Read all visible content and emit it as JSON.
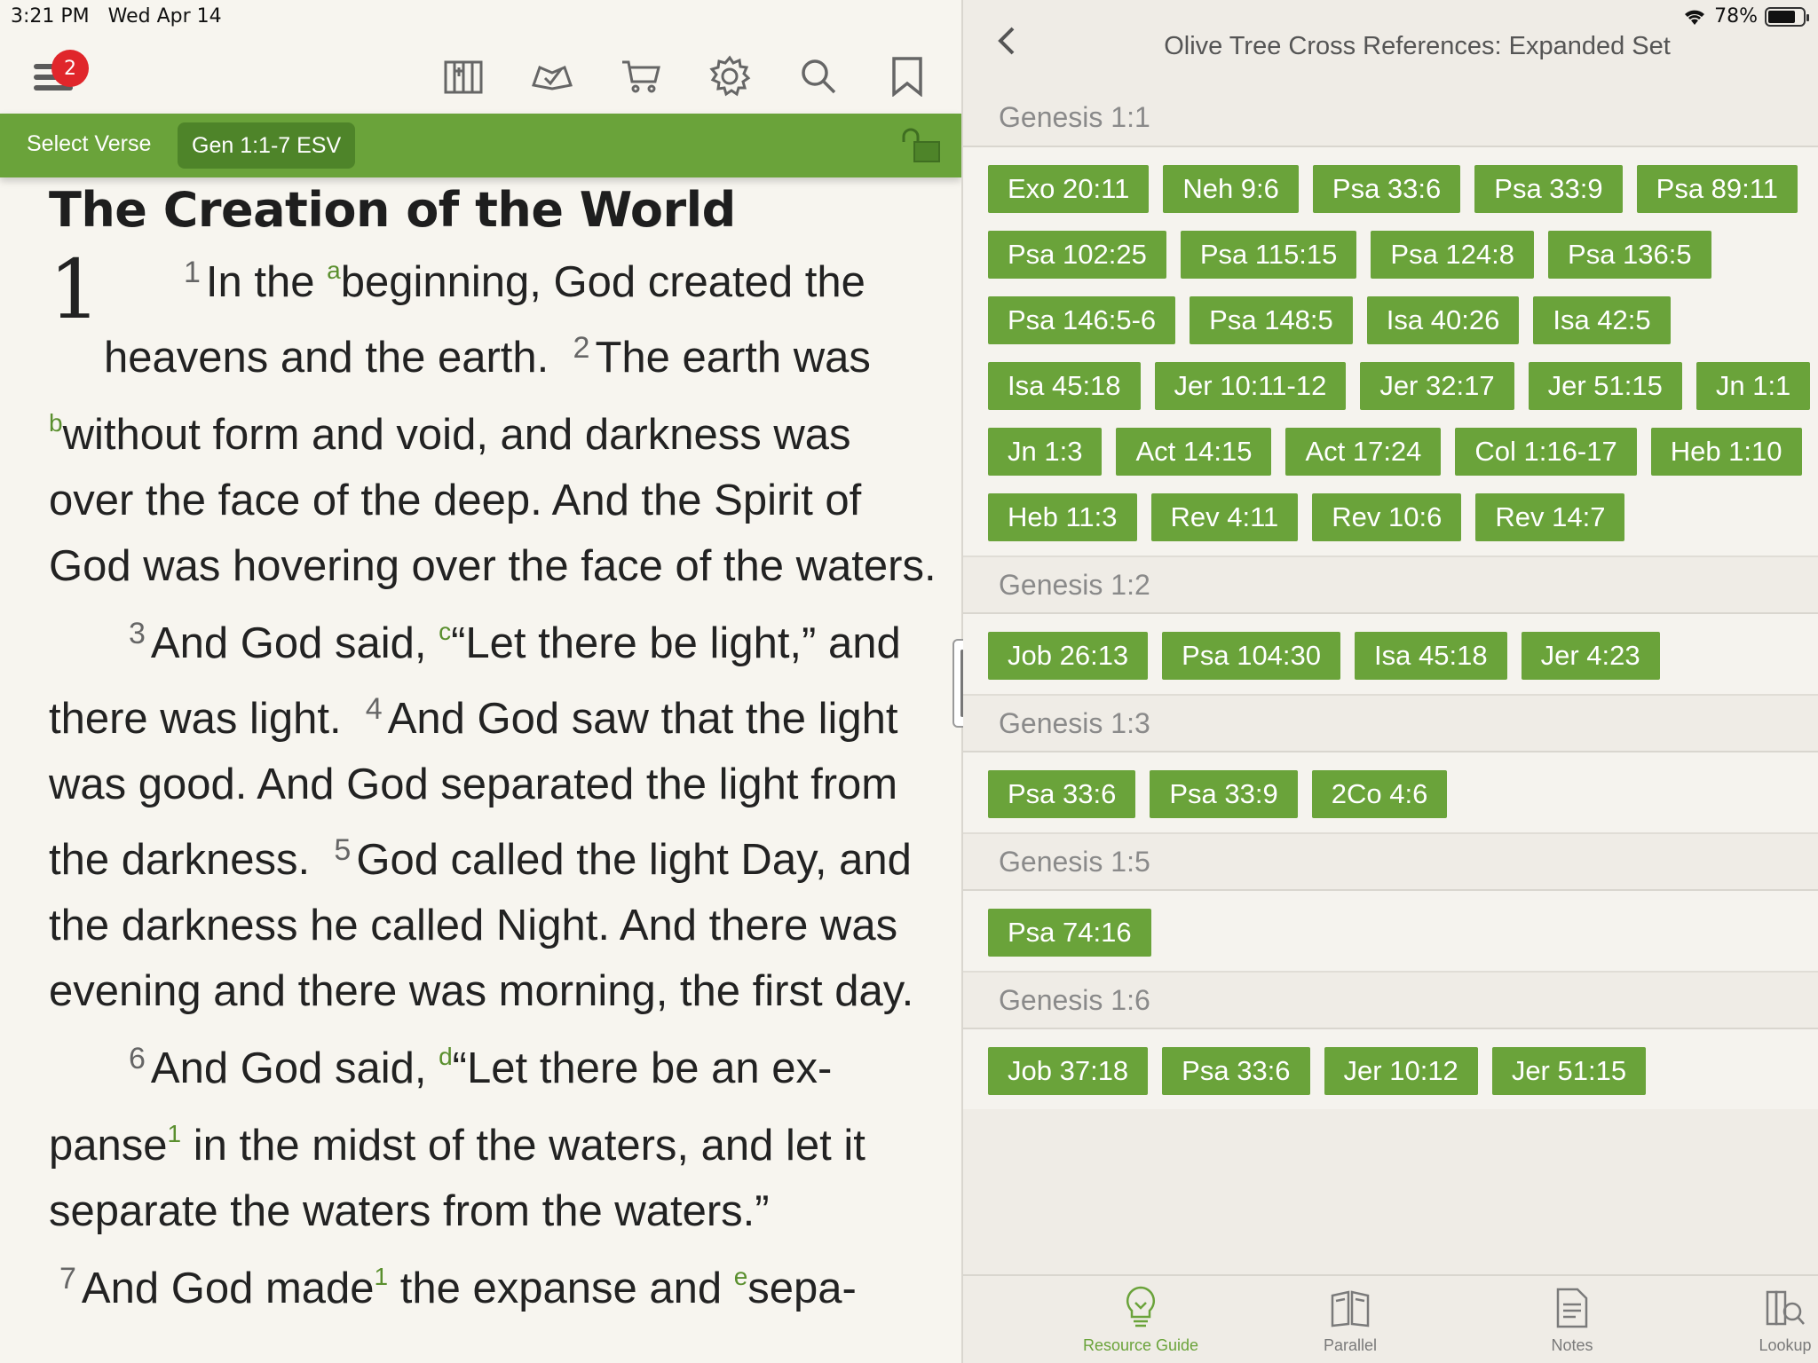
{
  "status": {
    "time": "3:21 PM",
    "date": "Wed Apr 14",
    "battery": "78%",
    "battery_level": 0.78
  },
  "toolbar": {
    "badge_count": "2",
    "icons": [
      "menu-icon",
      "library-icon",
      "reading-plan-icon",
      "cart-icon",
      "gear-icon",
      "search-icon",
      "bookmark-icon"
    ]
  },
  "verse_bar": {
    "select_label": "Select Verse",
    "reference": "Gen 1:1-7 ESV"
  },
  "reader": {
    "heading": "The Creation of the World",
    "chapter": "1",
    "v1_num": "1",
    "v1_a": "In the ",
    "fn_a": "a",
    "v1_b": "beginning, God created the heavens and the earth.",
    "v2_num": "2",
    "v2_a": "The earth was ",
    "fn_b": "b",
    "v2_b": "without form and void, and darkness was over the face of the deep. And the Spirit of God was hovering over the face of the waters.",
    "v3_num": "3",
    "v3_a": "And God said, ",
    "fn_c": "c",
    "v3_b": "“Let there be light,” and there was light.",
    "v4_num": "4",
    "v4": "And God saw that the light was good. And God separated the light from the darkness.",
    "v5_num": "5",
    "v5": "God called the light Day, and the darkness he called Night. And there was evening and there was morning, the first day.",
    "v6_num": "6",
    "v6_a": "And God said, ",
    "fn_d": "d",
    "v6_b": "“Let there be an ex­panse",
    "fn_1a": "1",
    "v6_c": " in the midst of the waters, and let it separate the waters from the waters.”",
    "v7_num": "7",
    "v7_a": "And God made",
    "fn_1b": "1",
    "v7_b": " the expanse and ",
    "fn_e": "e",
    "v7_c": "sepa-"
  },
  "resource": {
    "title": "Olive Tree Cross References: Expanded Set",
    "sections": [
      {
        "verse": "Genesis 1:1",
        "refs": [
          "Exo 20:11",
          "Neh 9:6",
          "Psa 33:6",
          "Psa 33:9",
          "Psa 89:11",
          "Psa 102:25",
          "Psa 115:15",
          "Psa 124:8",
          "Psa 136:5",
          "Psa 146:5-6",
          "Psa 148:5",
          "Isa 40:26",
          "Isa 42:5",
          "Isa 45:18",
          "Jer 10:11-12",
          "Jer 32:17",
          "Jer 51:15",
          "Jn 1:1",
          "Jn 1:3",
          "Act 14:15",
          "Act 17:24",
          "Col 1:16-17",
          "Heb 1:10",
          "Heb 11:3",
          "Rev 4:11",
          "Rev 10:6",
          "Rev 14:7"
        ]
      },
      {
        "verse": "Genesis 1:2",
        "refs": [
          "Job 26:13",
          "Psa 104:30",
          "Isa 45:18",
          "Jer 4:23"
        ]
      },
      {
        "verse": "Genesis 1:3",
        "refs": [
          "Psa 33:6",
          "Psa 33:9",
          "2Co 4:6"
        ]
      },
      {
        "verse": "Genesis 1:5",
        "refs": [
          "Psa 74:16"
        ]
      },
      {
        "verse": "Genesis 1:6",
        "refs": [
          "Job 37:18",
          "Psa 33:6",
          "Jer 10:12",
          "Jer 51:15"
        ]
      }
    ]
  },
  "tabs": [
    {
      "label": "Resource Guide",
      "icon": "lightbulb-icon",
      "active": true
    },
    {
      "label": "Parallel",
      "icon": "parallel-books-icon",
      "active": false
    },
    {
      "label": "Notes",
      "icon": "notes-icon",
      "active": false
    },
    {
      "label": "Lookup",
      "icon": "lookup-icon",
      "active": false
    }
  ],
  "colors": {
    "accent": "#6aa33a",
    "accent_dark": "#4e8429",
    "badge": "#e0262b",
    "page_bg": "#f7f5ef",
    "panel_bg": "#efece6"
  }
}
